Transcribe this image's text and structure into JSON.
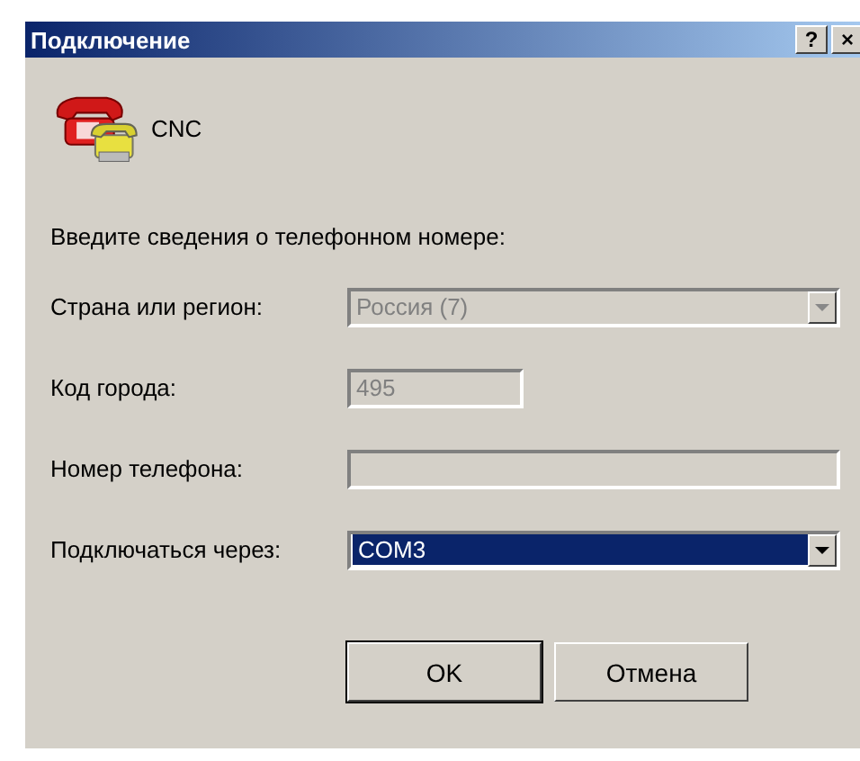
{
  "window": {
    "title": "Подключение",
    "buttons": [
      "?",
      "×"
    ]
  },
  "connection": {
    "name": "CNC"
  },
  "prompt": "Введите сведения о телефонном номере:",
  "fields": [
    {
      "label": "Страна или регион:",
      "kind": "combo",
      "value": "Россия (7)",
      "disabled": true,
      "focused": false,
      "wide": true
    },
    {
      "label": "Код города:",
      "kind": "text",
      "value": "495",
      "disabled": true,
      "focused": false,
      "wide": false
    },
    {
      "label": "Номер телефона:",
      "kind": "text",
      "disabled": true,
      "focused": false,
      "wide": true
    },
    {
      "label": "Подключаться через:",
      "kind": "combo",
      "value": "COM3",
      "disabled": false,
      "focused": true,
      "wide": true
    }
  ],
  "buttons": [
    {
      "label": "OK",
      "default": true
    },
    {
      "label": "Отмена",
      "default": false
    }
  ]
}
